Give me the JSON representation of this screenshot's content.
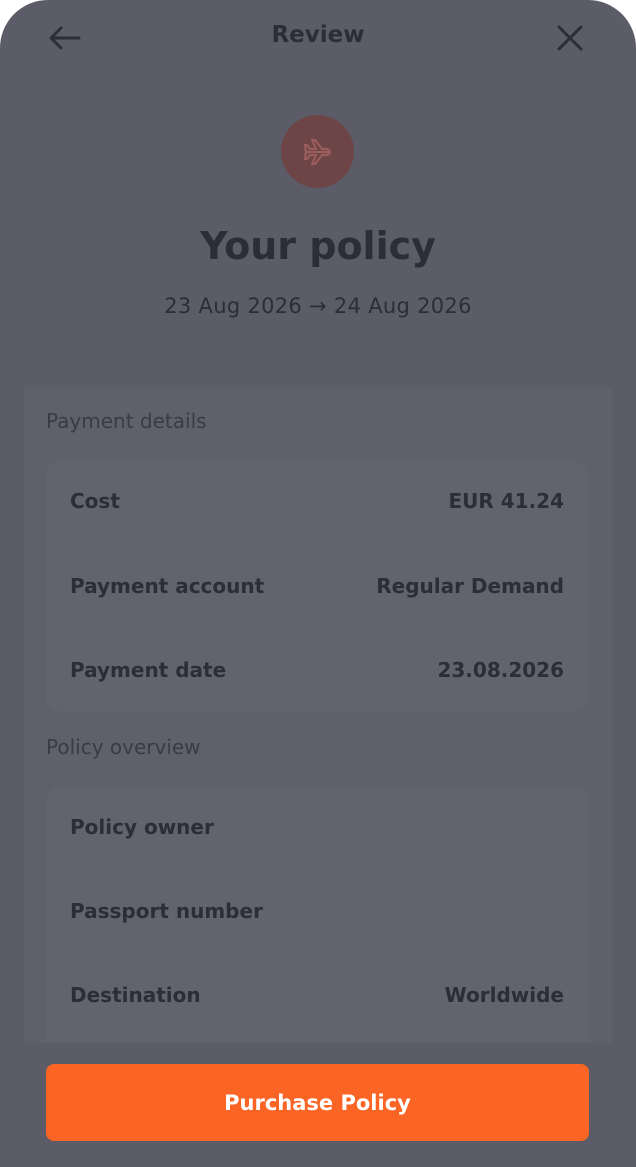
{
  "header": {
    "title": "Review",
    "back_icon": "arrow-left-icon",
    "close_icon": "close-icon"
  },
  "hero": {
    "icon": "airplane-icon",
    "headline": "Your policy",
    "date_range": "23 Aug 2026 → 24 Aug 2026"
  },
  "payment_details": {
    "label": "Payment details",
    "rows": [
      {
        "label": "Cost",
        "value": "EUR 41.24"
      },
      {
        "label": "Payment account",
        "value": "Regular Demand"
      },
      {
        "label": "Payment date",
        "value": "23.08.2026"
      }
    ]
  },
  "policy_overview": {
    "label": "Policy overview",
    "rows": [
      {
        "label": "Policy owner",
        "value": ""
      },
      {
        "label": "Passport number",
        "value": ""
      },
      {
        "label": "Destination",
        "value": "Worldwide"
      }
    ]
  },
  "cta": {
    "label": "Purchase Policy"
  },
  "colors": {
    "accent": "#fa6424",
    "overlay": "#5b5c68",
    "icon_circle": "#6d4547"
  }
}
